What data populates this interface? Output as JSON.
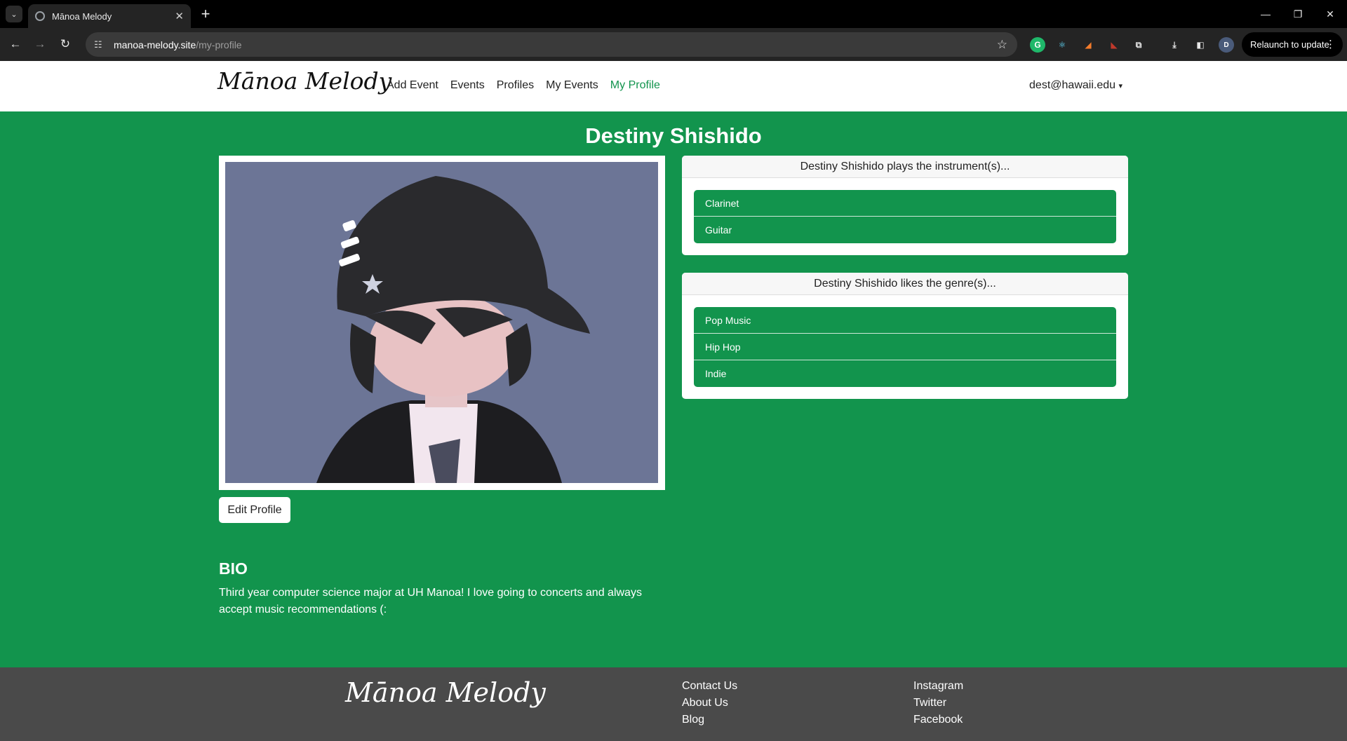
{
  "browser": {
    "tab_title": "Mānoa Melody",
    "url_host": "manoa-melody.site",
    "url_path": "/my-profile",
    "relaunch_label": "Relaunch to update",
    "profile_initial": "D"
  },
  "nav": {
    "brand": "Mānoa Melody",
    "links": [
      "Add Event",
      "Events",
      "Profiles",
      "My Events",
      "My Profile"
    ],
    "active": "My Profile",
    "user": "dest@hawaii.edu"
  },
  "profile": {
    "name": "Destiny Shishido",
    "edit_label": "Edit Profile",
    "bio_heading": "BIO",
    "bio_text": "Third year computer science major at UH Manoa! I love going to concerts and always accept music recommendations (:",
    "instruments_heading": "Destiny Shishido plays the instrument(s)...",
    "instruments": [
      "Clarinet",
      "Guitar"
    ],
    "genres_heading": "Destiny Shishido likes the genre(s)...",
    "genres": [
      "Pop Music",
      "Hip Hop",
      "Indie"
    ]
  },
  "footer": {
    "brand": "Mānoa Melody",
    "col1": [
      "Contact Us",
      "About Us",
      "Blog"
    ],
    "col2": [
      "Instagram",
      "Twitter",
      "Facebook"
    ]
  },
  "colors": {
    "primary_green": "#12944d",
    "footer_gray": "#4a4a4a",
    "photo_bg": "#6c7596"
  }
}
